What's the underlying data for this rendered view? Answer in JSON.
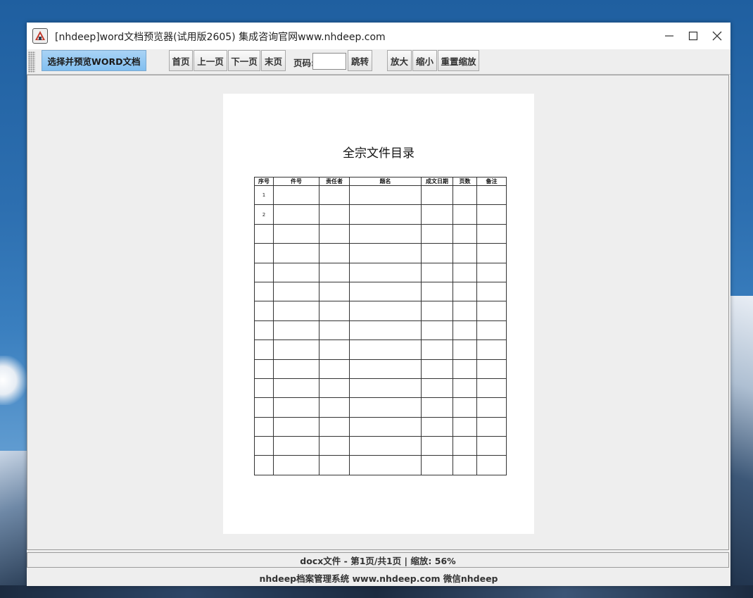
{
  "window": {
    "title": "[nhdeep]word文档预览器(试用版2605) 集成咨询官网www.nhdeep.com",
    "app_icon": "app-logo-icon",
    "controls": [
      "minimize-icon",
      "maximize-icon",
      "close-icon"
    ]
  },
  "toolbar": {
    "select_label": "选择并预览WORD文档",
    "first_label": "首页",
    "prev_label": "上一页",
    "next_label": "下一页",
    "last_label": "末页",
    "page_label": "页码:",
    "page_value": "",
    "jump_label": "跳转",
    "zoom_in_label": "放大",
    "zoom_out_label": "缩小",
    "reset_zoom_label": "重置缩放"
  },
  "document": {
    "title": "全宗文件目录",
    "columns": [
      "序号",
      "件号",
      "责任者",
      "题名",
      "成文日期",
      "页数",
      "备注"
    ],
    "rows": [
      [
        "1",
        "",
        "",
        "",
        "",
        "",
        ""
      ],
      [
        "2",
        "",
        "",
        "",
        "",
        "",
        ""
      ],
      [
        "",
        "",
        "",
        "",
        "",
        "",
        ""
      ],
      [
        "",
        "",
        "",
        "",
        "",
        "",
        ""
      ],
      [
        "",
        "",
        "",
        "",
        "",
        "",
        ""
      ],
      [
        "",
        "",
        "",
        "",
        "",
        "",
        ""
      ],
      [
        "",
        "",
        "",
        "",
        "",
        "",
        ""
      ],
      [
        "",
        "",
        "",
        "",
        "",
        "",
        ""
      ],
      [
        "",
        "",
        "",
        "",
        "",
        "",
        ""
      ],
      [
        "",
        "",
        "",
        "",
        "",
        "",
        ""
      ],
      [
        "",
        "",
        "",
        "",
        "",
        "",
        ""
      ],
      [
        "",
        "",
        "",
        "",
        "",
        "",
        ""
      ],
      [
        "",
        "",
        "",
        "",
        "",
        "",
        ""
      ],
      [
        "",
        "",
        "",
        "",
        "",
        "",
        ""
      ],
      [
        "",
        "",
        "",
        "",
        "",
        "",
        ""
      ]
    ]
  },
  "status": {
    "text": "docx文件 - 第1页/共1页 | 缩放: 56%"
  },
  "footer": {
    "text": "nhdeep档案管理系统 www.nhdeep.com 微信nhdeep"
  },
  "colors": {
    "primary_button": "#82bff0",
    "window_bg": "#eeeeee",
    "desktop": "#2d6fb0"
  }
}
